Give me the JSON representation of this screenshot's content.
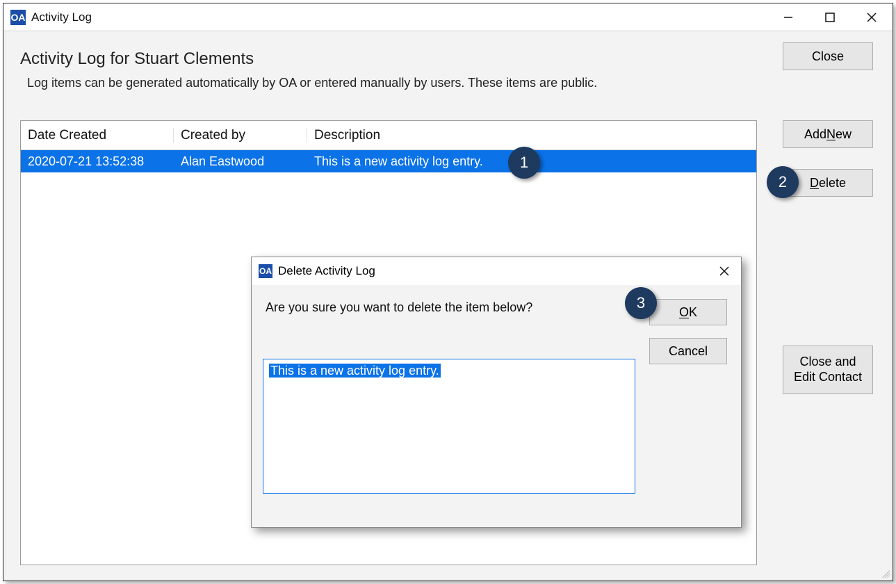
{
  "window": {
    "title": "Activity Log",
    "app_icon_text": "OA"
  },
  "page": {
    "heading": "Activity Log for Stuart Clements",
    "subheading": "Log items can be generated automatically by OA or entered manually by users. These items are public."
  },
  "buttons": {
    "close": "Close",
    "add_new_prefix": "Add ",
    "add_new_ul": "N",
    "add_new_suffix": "ew",
    "delete_ul": "D",
    "delete_suffix": "elete",
    "close_edit_line1": "Close and",
    "close_edit_line2": "Edit Contact"
  },
  "grid": {
    "headers": {
      "date": "Date Created",
      "by": "Created by",
      "desc": "Description"
    },
    "rows": [
      {
        "date": "2020-07-21 13:52:38",
        "by": "Alan Eastwood",
        "desc": "This is a new activity log entry."
      }
    ]
  },
  "callouts": {
    "c1": "1",
    "c2": "2",
    "c3": "3"
  },
  "dialog": {
    "title": "Delete Activity Log",
    "message": "Are you sure you want to delete the item below?",
    "ok_ul": "O",
    "ok_suffix": "K",
    "cancel": "Cancel",
    "text_value": "This is a new activity log entry."
  }
}
